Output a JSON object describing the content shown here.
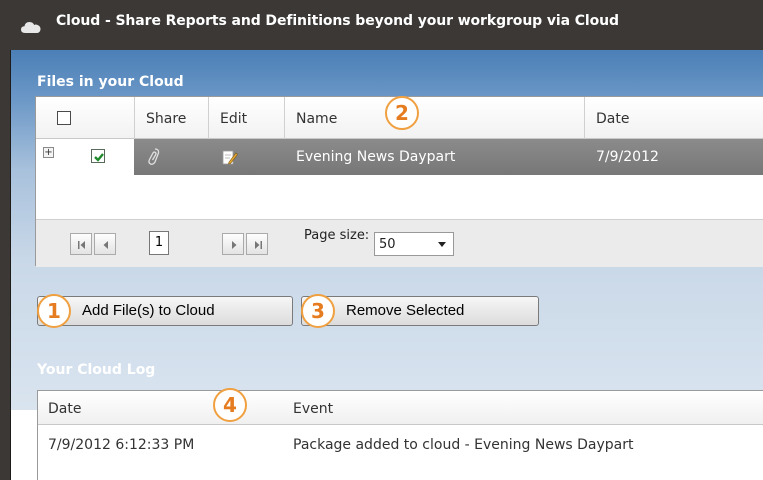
{
  "window": {
    "title": "Cloud - Share Reports and Definitions beyond your workgroup via Cloud"
  },
  "files_panel": {
    "title": "Files in your Cloud",
    "columns": [
      "Share",
      "Edit",
      "Name",
      "Date"
    ],
    "rows": [
      {
        "expand": "+",
        "checked": true,
        "name": "Evening News Daypart",
        "date": "7/9/2012"
      }
    ],
    "pager": {
      "current_page": "1",
      "page_size_label": "Page size:",
      "page_size_value": "50"
    }
  },
  "actions": {
    "add_label": "Add File(s) to Cloud",
    "remove_label": "Remove Selected"
  },
  "log_panel": {
    "title": "Your Cloud Log",
    "columns": [
      "Date",
      "Event"
    ],
    "rows": [
      {
        "date": "7/9/2012 6:12:33 PM",
        "event": "Package added to cloud - Evening News Daypart"
      }
    ]
  },
  "callouts": [
    "1",
    "2",
    "3",
    "4"
  ],
  "colors": {
    "title_bar": "#3b3836",
    "panel_top": "#4b7fb6",
    "selected_row": "#808080",
    "callout_border": "#f0a040",
    "callout_text": "#e67c20"
  },
  "icons": [
    "cloud-icon",
    "share-icon",
    "edit-icon",
    "first-page-icon",
    "prev-page-icon",
    "next-page-icon",
    "last-page-icon",
    "dropdown-arrow-icon",
    "checkmark-icon"
  ]
}
